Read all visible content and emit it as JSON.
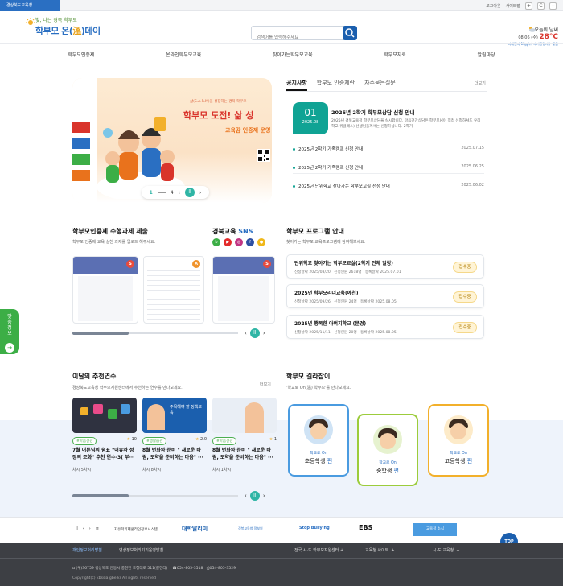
{
  "topbar": {
    "org": "경상북도교육청",
    "links": [
      "로그아웃",
      "사이트맵"
    ],
    "buttons": [
      "+",
      "C",
      "−"
    ]
  },
  "logo": {
    "tagline": "빛, 나는 경북 학부모",
    "name_a": "학부모 온(",
    "name_b": "溫",
    "name_c": ")데이"
  },
  "search": {
    "placeholder": "검색어를 입력해주세요"
  },
  "weather": {
    "label": "오늘의 날씨",
    "date": "08.06 (수)",
    "temp": "28°C",
    "detail": "미세먼지 13㎍/㎥ 대기환경지수 좋음"
  },
  "nav": [
    "학부모인증제",
    "온라인학부모교육",
    "찾아가는학부모교육",
    "학부모자료",
    "알림마당"
  ],
  "hero": {
    "small": "삶(S.A.R.M)을 성장하는 경북 학부모 ",
    "headline": "학부모 도전! 삶 성",
    "sub": "교육감 인증제 운영",
    "page_current": "1",
    "page_total": "4",
    "colors": [
      "#d9342b",
      "#2a6fc2",
      "#3cae46",
      "#e9721c"
    ]
  },
  "notice": {
    "tabs": [
      "공지사항",
      "학부모 인증제란",
      "자주묻는질문"
    ],
    "more": "더보기",
    "featured": {
      "day": "01",
      "month": "2025.08",
      "title": "2025년 2학기 학부모상담 신청 안내",
      "desc": "2025년 경북교육청 학부모상담을 실시합니다. 마음건강상담은 학부모님이 직접 신청하셔도 우리 학교(위클래스) 선생님들께서는 신청하십니다. 2학기 ···"
    },
    "items": [
      {
        "title": "2025년 2학기 가족캠프 신청 안내",
        "date": "2025.07.15"
      },
      {
        "title": "2025년 2학기 가족캠프 신청 안내",
        "date": "2025.06.25"
      },
      {
        "title": "2025년 단위학교 찾아가는 학부모교실 선정 안내",
        "date": "2025.06.02"
      }
    ]
  },
  "cert": {
    "title": "학부모인증제 수행과제 제출",
    "desc": "학부모 인증제 교육 실천 과제를 업로드 해주세요.",
    "badges": [
      "S",
      "A"
    ]
  },
  "sns": {
    "title_a": "경북교육 ",
    "title_b": "SNS",
    "icons": [
      {
        "name": "blog-icon",
        "color": "#3cae46",
        "glyph": "b"
      },
      {
        "name": "youtube-icon",
        "color": "#e32b2b",
        "glyph": "▶"
      },
      {
        "name": "instagram-icon",
        "color": "#c13584",
        "glyph": "◎"
      },
      {
        "name": "facebook-icon",
        "color": "#2d4fa2",
        "glyph": "f"
      },
      {
        "name": "kakao-icon",
        "color": "#f0b81a",
        "glyph": "●"
      }
    ],
    "badges": [
      "S"
    ]
  },
  "programs": {
    "title": "학부모 프로그램 안내",
    "desc": "찾아가는 학부모 교육프로그램에 참여해보세요.",
    "labels": {
      "apply": "신청날짜",
      "people": "신청인원",
      "reg": "등록날짜"
    },
    "items": [
      {
        "title": "단위학교 찾아가는 학부모교실(2학기 전체 일정)",
        "apply": "2025/08/20",
        "people": "2618명",
        "reg": "2025.07.01",
        "status": "접수중"
      },
      {
        "title": "2025년 학부모리더교육(예천)",
        "apply": "2025/09/26",
        "people": "24명",
        "reg": "2025.08.05",
        "status": "접수중"
      },
      {
        "title": "2025년 행복한 아버지학교 (문경)",
        "apply": "2025/11/11",
        "people": "20명",
        "reg": "2025.08.05",
        "status": "접수중"
      }
    ]
  },
  "recommend": {
    "title": "이달의 추천연수",
    "desc": "경상북도교육청 학부모지원센터에서 추천하는 연수를 만나보세요.",
    "more": "더보기",
    "items": [
      {
        "tag": "#마음건강",
        "score": "10",
        "title": "7월 어른님의 쉼표 \"어유와 성장의 조화\" 추천 연수-3( 부···",
        "meta": "차시  5차시"
      },
      {
        "tag": "#생활습관",
        "score": "2.0",
        "title": "8월 변화와 준비 \" 새로운 바람, 도약을 준비하는 마음\" ···",
        "meta": "차시  8차시"
      },
      {
        "tag": "#마음건강",
        "score": "1",
        "title": "8월 변화와 준비 \" 새로운 바람, 도약을 준비하는 마음\" ···",
        "meta": "차시  1차시"
      }
    ],
    "thumb_text": "주목해야 할 정책교육"
  },
  "guide": {
    "title": "학부모 길라잡이",
    "desc": "'학교로 On(溫) 학부모'를 만나보세요.",
    "small": "학교로 On",
    "items": [
      {
        "name": "초등학생",
        "suffix": "편",
        "color": "#4a9be0"
      },
      {
        "name": "중학생",
        "suffix": "편",
        "color": "#9ccc3c"
      },
      {
        "name": "고등학생",
        "suffix": "편",
        "color": "#f2b02b"
      }
    ]
  },
  "partners": {
    "label": "자유학기제온라인정보시스템",
    "logos": [
      "대학알리미",
      "경북교육청 정보원",
      "Stop Bullying",
      "EBS",
      "교육청 소식"
    ]
  },
  "footer": {
    "links": [
      "개인정보처리방침",
      "영상정보처리기기운영방침"
    ],
    "selects": [
      "전국 시·도 학부모지원센터",
      "교육청 사이트",
      "시·도 교육청"
    ],
    "address": "(우)36759 경상북도 안동시 풍천면 도청대로 511(갈전리)",
    "tel": "054-805-3518",
    "fax": "054-805-3529",
    "copyright": "Copyright(c) kbssia.gbe.kr All rights reserved"
  },
  "top_button": "TOP",
  "side": "맞춤정보"
}
